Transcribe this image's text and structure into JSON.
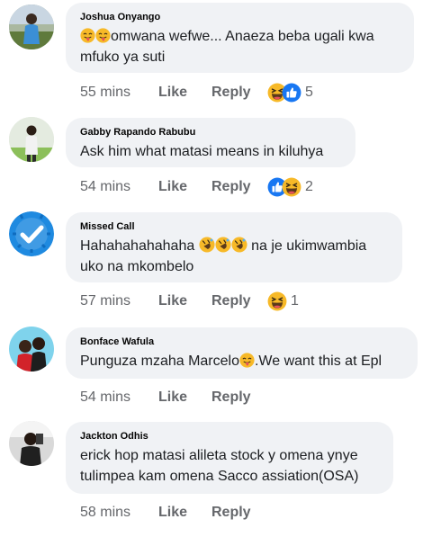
{
  "comments": [
    {
      "author": "Joshua Onyango",
      "text_before": "omwana wefwe... Anaeza beba ugali kwa mfuko ya suti",
      "text_lines": [
        "omwana wefwe... Anaeza beba ugali kwa",
        "mfuko ya suti"
      ],
      "time": "55 mins",
      "like": "Like",
      "reply": "Reply",
      "reaction_count": "5",
      "reactions": [
        "haha-icon",
        "like-icon"
      ]
    },
    {
      "author": "Gabby Rapando Rabubu",
      "text_lines": [
        "Ask him what matasi means in kiluhya"
      ],
      "time": "54 mins",
      "like": "Like",
      "reply": "Reply",
      "reaction_count": "2",
      "reactions": [
        "like-icon",
        "haha-icon"
      ]
    },
    {
      "author": "Missed Call",
      "text_lines": [
        "Hahahahahahaha",
        " na je ukimwambia",
        "uko na mkombelo"
      ],
      "time": "57 mins",
      "like": "Like",
      "reply": "Reply",
      "reaction_count": "1",
      "reactions": [
        "haha-icon"
      ]
    },
    {
      "author": "Bonface Wafula",
      "text_lines": [
        "Punguza mzaha Marcelo",
        ".We want this at Epl"
      ],
      "time": "54 mins",
      "like": "Like",
      "reply": "Reply"
    },
    {
      "author": "Jackton Odhis",
      "text_lines": [
        "erick hop matasi alileta stock y omena ynye",
        "tulimpea kam omena Sacco assiation(OSA)"
      ],
      "time": "58 mins",
      "like": "Like",
      "reply": "Reply"
    }
  ],
  "colors": {
    "bubble": "#f0f2f5",
    "meta": "#65676b",
    "like_blue": "#1877f2",
    "haha_yellow": "#f7b125"
  }
}
